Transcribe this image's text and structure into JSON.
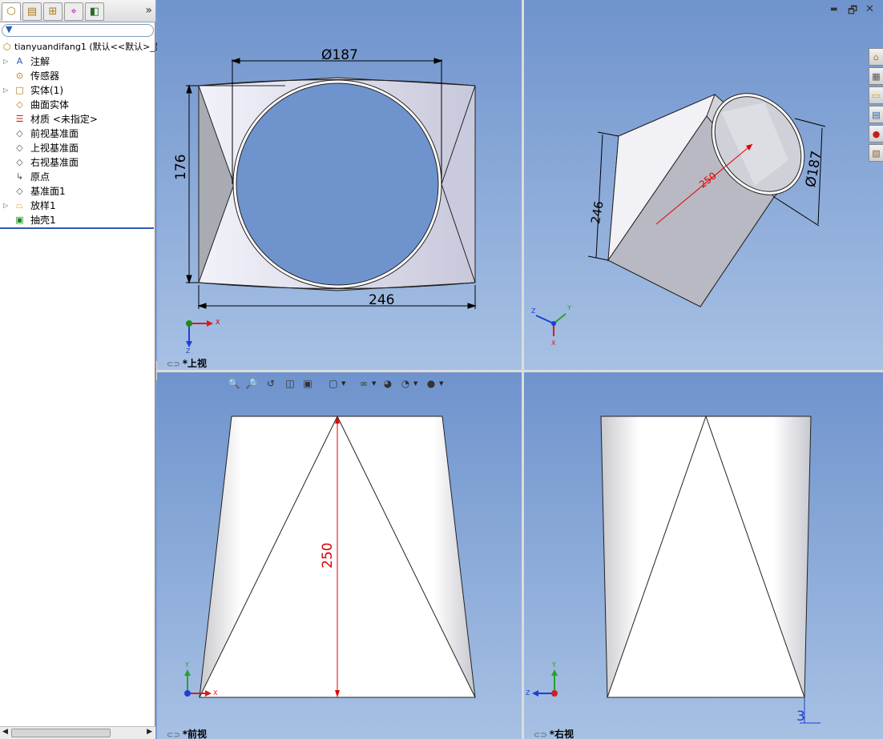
{
  "feature_tree": {
    "tabs": [
      {
        "icon": "feature-manager-icon",
        "glyph": "⬡"
      },
      {
        "icon": "property-manager-icon",
        "glyph": "▤"
      },
      {
        "icon": "configuration-manager-icon",
        "glyph": "⊞"
      },
      {
        "icon": "dimxpert-icon",
        "glyph": "⌖"
      },
      {
        "icon": "display-manager-icon",
        "glyph": "◧"
      }
    ],
    "more": "»",
    "filter_icon": "filter-icon",
    "root": "tianyuandifang1 (默认<<默认>_显",
    "items": [
      {
        "label": "注解",
        "icon": "annotations-icon",
        "glyph": "A",
        "expand": true
      },
      {
        "label": "传感器",
        "icon": "sensors-icon",
        "glyph": "⊙",
        "expand": false
      },
      {
        "label": "实体(1)",
        "icon": "solid-bodies-icon",
        "glyph": "□",
        "expand": true
      },
      {
        "label": "曲面实体",
        "icon": "surface-bodies-icon",
        "glyph": "◇",
        "expand": false
      },
      {
        "label": "材质 <未指定>",
        "icon": "material-icon",
        "glyph": "☰",
        "expand": false
      },
      {
        "label": "前视基准面",
        "icon": "plane-icon",
        "glyph": "◇",
        "expand": false
      },
      {
        "label": "上视基准面",
        "icon": "plane-icon",
        "glyph": "◇",
        "expand": false
      },
      {
        "label": "右视基准面",
        "icon": "plane-icon",
        "glyph": "◇",
        "expand": false
      },
      {
        "label": "原点",
        "icon": "origin-icon",
        "glyph": "↳",
        "expand": false
      },
      {
        "label": "基准面1",
        "icon": "plane-icon",
        "glyph": "◇",
        "expand": false
      },
      {
        "label": "放样1",
        "icon": "loft-icon",
        "glyph": "⏢",
        "expand": true
      },
      {
        "label": "抽壳1",
        "icon": "shell-icon",
        "glyph": "▣",
        "expand": false
      }
    ]
  },
  "views": {
    "top": {
      "name": "*上视",
      "dim_diameter": "Ø187",
      "dim_width": "246",
      "dim_height": "176"
    },
    "iso": {
      "dim_length": "250",
      "dim_diameter": "Ø187",
      "dim_side": "246"
    },
    "front": {
      "name": "*前视",
      "dim_height": "250"
    },
    "right": {
      "name": "*右视",
      "dim_small": "3"
    }
  },
  "axes": {
    "x": "X",
    "y": "Y",
    "z": "Z"
  },
  "colors": {
    "dimension_black": "#000000",
    "dimension_red": "#e00000",
    "x_axis": "#d81c1c",
    "y_axis": "#27a127",
    "z_axis": "#1c3fd8"
  },
  "view_toolbar": [
    "zoom-to-fit-icon",
    "zoom-area-icon",
    "previous-view-icon",
    "section-view-icon",
    "view-orientation-icon",
    "display-style-icon",
    "hide-show-icon",
    "edit-appearance-icon",
    "apply-scene-icon",
    "view-settings-icon"
  ],
  "window_controls": {
    "restore": "🗗",
    "close": "✕",
    "minimize": "▬"
  },
  "task_pane": [
    "home-icon",
    "design-library-icon",
    "file-explorer-icon",
    "view-palette-icon",
    "appearances-icon",
    "custom-properties-icon"
  ]
}
